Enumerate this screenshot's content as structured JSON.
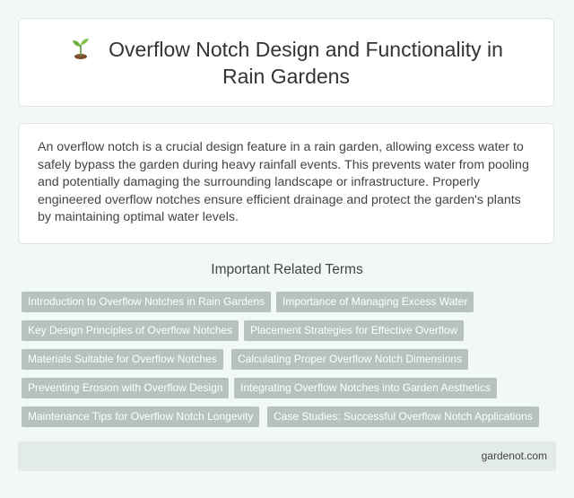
{
  "header": {
    "icon": "sprout-icon",
    "title": "Overflow Notch Design and Functionality in Rain Gardens"
  },
  "summary": {
    "text": "An overflow notch is a crucial design feature in a rain garden, allowing excess water to safely bypass the garden during heavy rainfall events. This prevents water from pooling and potentially damaging the surrounding landscape or infrastructure. Properly engineered overflow notches ensure efficient drainage and protect the garden's plants by maintaining optimal water levels."
  },
  "related": {
    "heading": "Important Related Terms",
    "terms": [
      "Introduction to Overflow Notches in Rain Gardens",
      "Importance of Managing Excess Water",
      "Key Design Principles of Overflow Notches",
      "Placement Strategies for Effective Overflow",
      "Materials Suitable for Overflow Notches",
      "Calculating Proper Overflow Notch Dimensions",
      "Preventing Erosion with Overflow Design",
      "Integrating Overflow Notches into Garden Aesthetics",
      "Maintenance Tips for Overflow Notch Longevity",
      "Case Studies: Successful Overflow Notch Applications"
    ]
  },
  "footer": {
    "site": "gardenot.com"
  },
  "colors": {
    "background": "#f2f8f4",
    "tag": "#b6c3bc",
    "footer": "#e2ebe6"
  }
}
